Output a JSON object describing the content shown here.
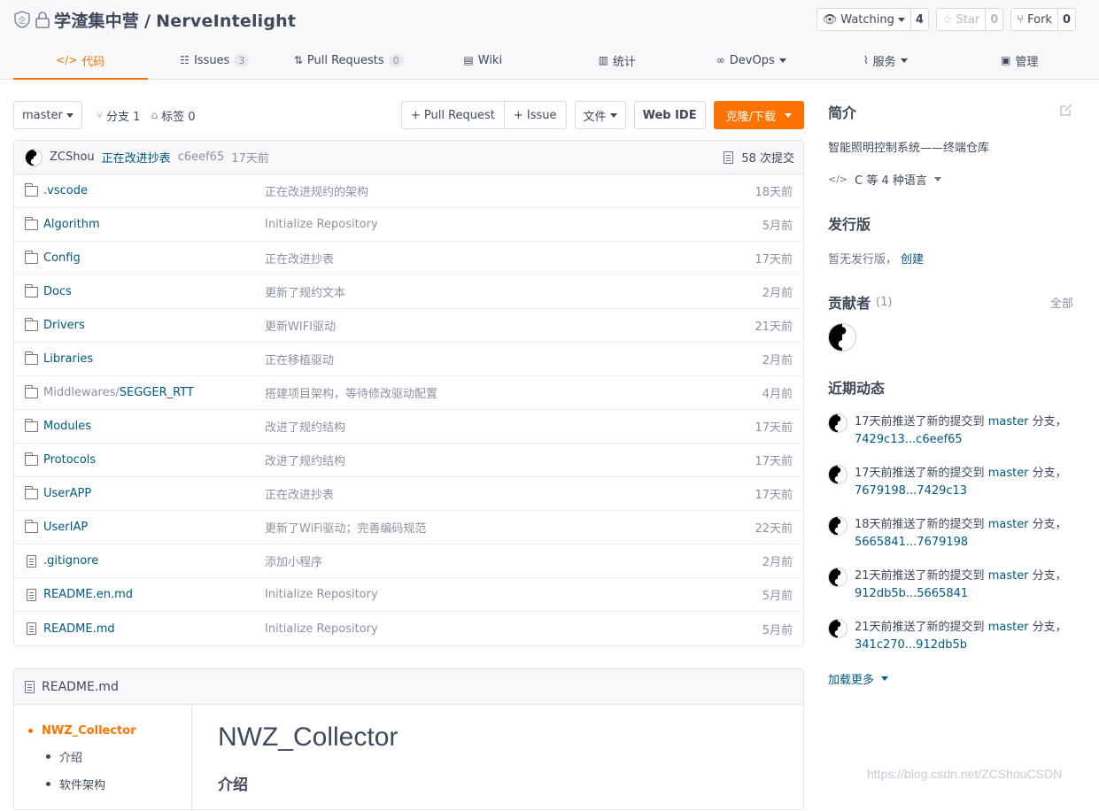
{
  "repo": {
    "owner": "学渣集中营",
    "name": "NerveIntelight"
  },
  "actions": {
    "watch": {
      "label": "Watching",
      "count": "4"
    },
    "star": {
      "label": "Star",
      "count": "0"
    },
    "fork": {
      "label": "Fork",
      "count": "0"
    }
  },
  "tabs": [
    {
      "label": "代码"
    },
    {
      "label": "Issues",
      "badge": "3"
    },
    {
      "label": "Pull Requests",
      "badge": "0"
    },
    {
      "label": "Wiki"
    },
    {
      "label": "统计"
    },
    {
      "label": "DevOps"
    },
    {
      "label": "服务"
    },
    {
      "label": "管理"
    }
  ],
  "toolbar": {
    "branch": "master",
    "branches_label": "分支 1",
    "tags_label": "标签 0",
    "pull_request": "+ Pull Request",
    "issue": "+ Issue",
    "file": "文件",
    "webide": "Web IDE",
    "clone": "克隆/下载"
  },
  "commit": {
    "author": "ZCShou",
    "message": "正在改进抄表",
    "sha": "c6eef65",
    "time": "17天前",
    "count": "58 次提交"
  },
  "files": [
    {
      "name": ".vscode",
      "msg": "正在改进规约的架构",
      "time": "18天前"
    },
    {
      "name": "Algorithm",
      "msg": "Initialize Repository",
      "time": "5月前"
    },
    {
      "name": "Config",
      "msg": "正在改进抄表",
      "time": "17天前"
    },
    {
      "name": "Docs",
      "msg": "更新了规约文本",
      "time": "2月前"
    },
    {
      "name": "Drivers",
      "msg": "更新WIFI驱动",
      "time": "21天前"
    },
    {
      "name": "Libraries",
      "msg": "正在移植驱动",
      "time": "2月前"
    },
    {
      "name_prefix": "Middlewares/",
      "name": "SEGGER_RTT",
      "msg": "搭建项目架构，等待修改驱动配置",
      "time": "4月前"
    },
    {
      "name": "Modules",
      "msg": "改进了规约结构",
      "time": "17天前"
    },
    {
      "name": "Protocols",
      "msg": "改进了规约结构",
      "time": "17天前"
    },
    {
      "name": "UserAPP",
      "msg": "正在改进抄表",
      "time": "17天前"
    },
    {
      "name": "UserIAP",
      "msg": "更新了WiFi驱动；完善编码规范",
      "time": "22天前"
    },
    {
      "name": ".gitignore",
      "msg": "添加小程序",
      "time": "2月前"
    },
    {
      "name": "README.en.md",
      "msg": "Initialize Repository",
      "time": "5月前"
    },
    {
      "name": "README.md",
      "msg": "Initialize Repository",
      "time": "5月前"
    }
  ],
  "readme": {
    "filename": "README.md",
    "toc": [
      "NWZ_Collector",
      "介绍",
      "软件架构"
    ],
    "h1": "NWZ_Collector",
    "h2": "介绍"
  },
  "sidebar": {
    "intro_title": "简介",
    "description": "智能照明控制系统——终端仓库",
    "languages": "C 等 4 种语言",
    "release_title": "发行版",
    "release_text": "暂无发行版，",
    "release_link": "创建",
    "contrib_title": "贡献者",
    "contrib_count": "(1)",
    "contrib_all": "全部",
    "activity_title": "近期动态",
    "activities": [
      {
        "pre": "17天前推送了新的提交到 ",
        "branch": "master",
        "post": " 分支，",
        "range": "7429c13...c6eef65"
      },
      {
        "pre": "17天前推送了新的提交到 ",
        "branch": "master",
        "post": " 分支，",
        "range": "7679198...7429c13"
      },
      {
        "pre": "18天前推送了新的提交到 ",
        "branch": "master",
        "post": " 分支，",
        "range": "5665841...7679198"
      },
      {
        "pre": "21天前推送了新的提交到 ",
        "branch": "master",
        "post": " 分支，",
        "range": "912db5b...5665841"
      },
      {
        "pre": "21天前推送了新的提交到 ",
        "branch": "master",
        "post": " 分支，",
        "range": "341c270...912db5b"
      }
    ],
    "load_more": "加载更多"
  },
  "watermark": "https://blog.csdn.net/ZCShouCSDN",
  "colors": {
    "accent": "#fe7300",
    "link": "#005980"
  }
}
